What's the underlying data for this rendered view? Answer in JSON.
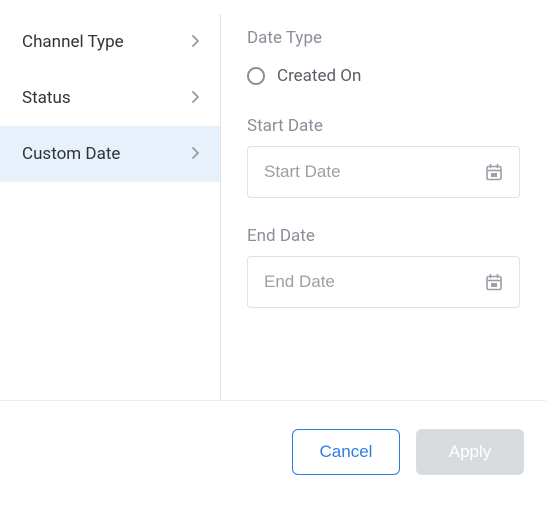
{
  "sidebar": {
    "items": [
      {
        "label": "Channel Type",
        "active": false
      },
      {
        "label": "Status",
        "active": false
      },
      {
        "label": "Custom Date",
        "active": true
      }
    ]
  },
  "content": {
    "date_type_title": "Date Type",
    "date_type_option": "Created On",
    "start_date_label": "Start Date",
    "start_date_placeholder": "Start Date",
    "end_date_label": "End Date",
    "end_date_placeholder": "End Date"
  },
  "footer": {
    "cancel_label": "Cancel",
    "apply_label": "Apply"
  }
}
